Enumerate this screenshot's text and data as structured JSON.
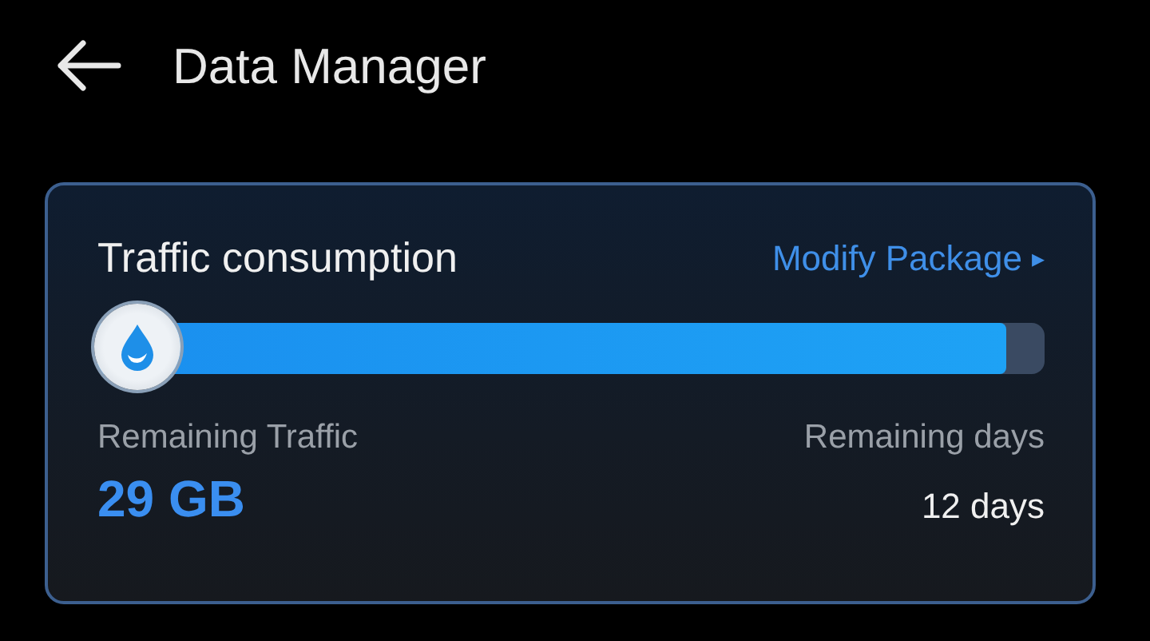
{
  "header": {
    "title": "Data Manager"
  },
  "card": {
    "title": "Traffic consumption",
    "link": "Modify Package",
    "link_caret": "▸",
    "usage": {
      "level": 0.96
    },
    "remaining_traffic": {
      "label": "Remaining Traffic",
      "value": "29 GB"
    },
    "remaining_days": {
      "label": "Remaining days",
      "value": "12 days"
    }
  }
}
